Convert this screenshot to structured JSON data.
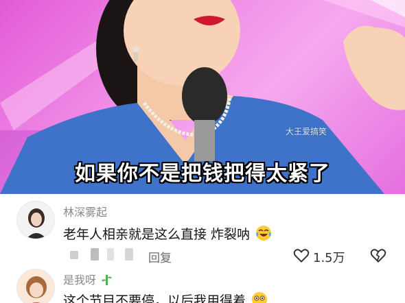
{
  "video": {
    "watermark": "大王爱搞笑",
    "subtitle": "如果你不是把钱把得太紧了"
  },
  "comments": [
    {
      "username": "林深雾起",
      "text": "老年人相亲就是这么直接 炸裂呐",
      "emoji": "laughing-crying-emoji",
      "reply_label": "回复",
      "like_count": "1.5万"
    },
    {
      "username": "是我呀",
      "text": "这个节目不要停，以后我用得着",
      "emoji": "flushed-emoji"
    }
  ],
  "colors": {
    "background": "#ffffff",
    "username": "#8a8a8a",
    "comment_text": "#151515",
    "stage_pink": "#f08be6",
    "dress_blue": "#3f73c9"
  }
}
